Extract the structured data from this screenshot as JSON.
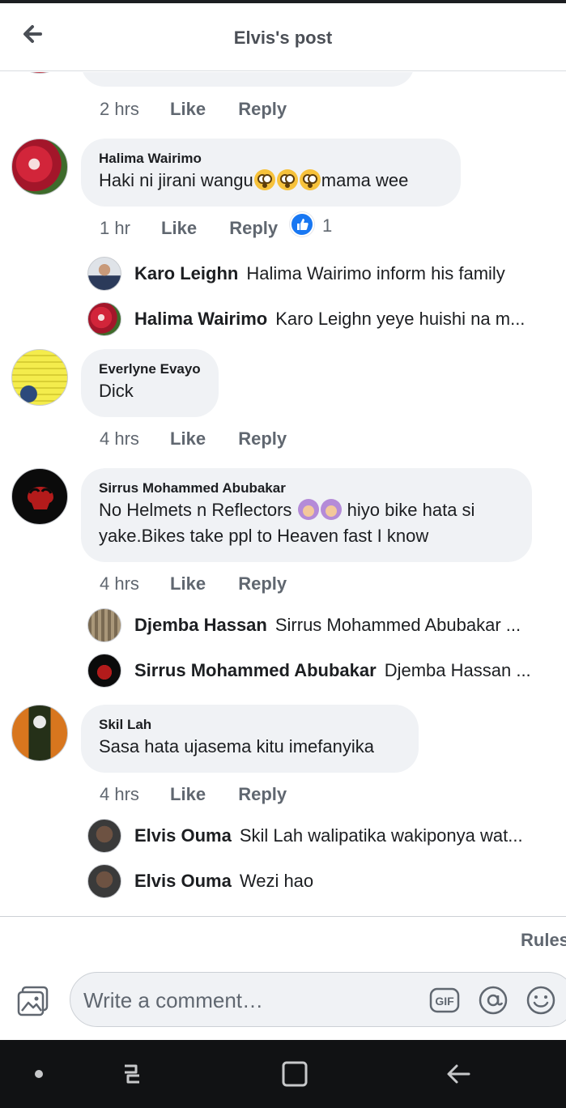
{
  "header": {
    "title": "Elvis's post"
  },
  "comments": [
    {
      "time": "2 hrs",
      "like": "Like",
      "reply": "Reply"
    },
    {
      "author": "Halima Wairimo",
      "text_before": "Haki ni jirani wangu",
      "text_after": "mama wee",
      "time": "1 hr",
      "like": "Like",
      "reply": "Reply",
      "reaction_count": "1",
      "replies": [
        {
          "name": "Karo Leighn",
          "text": "Halima Wairimo inform his family"
        },
        {
          "name": "Halima Wairimo",
          "text": "Karo Leighn yeye huishi na m..."
        }
      ]
    },
    {
      "author": "Everlyne Evayo",
      "text": "Dick",
      "time": "4 hrs",
      "like": "Like",
      "reply": "Reply"
    },
    {
      "author": "Sirrus Mohammed Abubakar",
      "text_before": "No Helmets n Reflectors",
      "text_after": "hiyo bike hata si",
      "text_line2": "yake.Bikes take ppl to Heaven fast I know",
      "time": "4 hrs",
      "like": "Like",
      "reply": "Reply",
      "replies": [
        {
          "name": "Djemba Hassan",
          "text": "Sirrus Mohammed Abubakar ..."
        },
        {
          "name": "Sirrus Mohammed Abubakar",
          "text": "Djemba Hassan ..."
        }
      ]
    },
    {
      "author": "Skil Lah",
      "text": "Sasa hata ujasema kitu imefanyika",
      "time": "4 hrs",
      "like": "Like",
      "reply": "Reply",
      "replies": [
        {
          "name": "Elvis Ouma",
          "text": "Skil Lah walipatika wakiponya wat..."
        },
        {
          "name": "Elvis Ouma",
          "text": "Wezi hao"
        }
      ]
    }
  ],
  "footer": {
    "rules": "Rules",
    "composer_placeholder": "Write a comment…",
    "gif_label": "GIF"
  }
}
